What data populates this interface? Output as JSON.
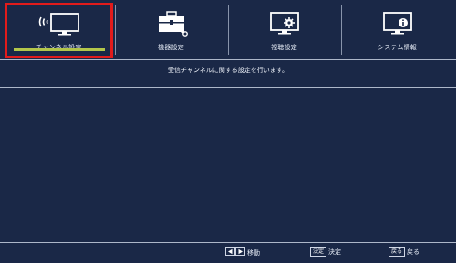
{
  "menu": {
    "tabs": [
      {
        "label": "チャンネル設定",
        "icon": "antenna-tv-icon",
        "selected": true
      },
      {
        "label": "機器設定",
        "icon": "toolbox-icon",
        "selected": false
      },
      {
        "label": "視聴設定",
        "icon": "monitor-gear-icon",
        "selected": false
      },
      {
        "label": "システム情報",
        "icon": "monitor-info-icon",
        "selected": false
      }
    ]
  },
  "description": "受信チャンネルに関する設定を行います。",
  "footer": {
    "move_label": "移動",
    "confirm_key": "決定",
    "confirm_label": "決定",
    "back_key": "戻る",
    "back_label": "戻る"
  },
  "colors": {
    "background": "#1a2847",
    "selection_frame": "#e21b1b",
    "selection_underline": "#b3c64a"
  }
}
